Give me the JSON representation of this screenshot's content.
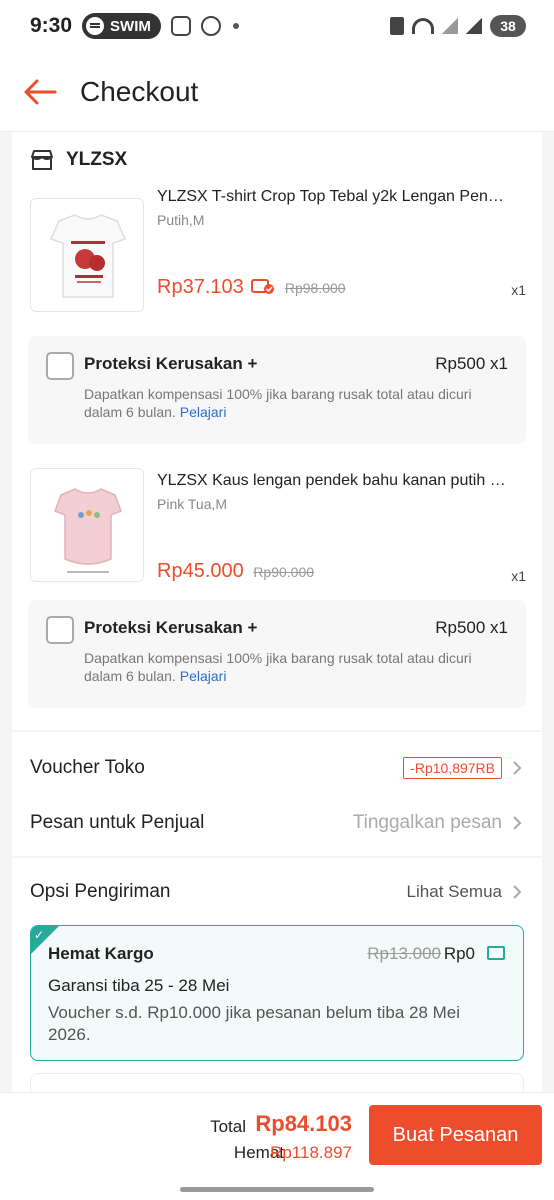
{
  "status_bar": {
    "time": "9:30",
    "pill_label": "SWIM",
    "battery": "38"
  },
  "header": {
    "title": "Checkout",
    "back_icon": "arrow-left-icon"
  },
  "shop": {
    "name": "YLZSX",
    "icon": "store-icon"
  },
  "items": [
    {
      "name": "YLZSX T-shirt Crop Top Tebal y2k Lengan Pen…",
      "variant": "Putih,M",
      "price": "Rp37.103",
      "old_price": "Rp98.000",
      "qty": "x1",
      "protection": {
        "title": "Proteksi Kerusakan +",
        "price": "Rp500 x1",
        "desc": "Dapatkan kompensasi 100% jika barang rusak total atau dicuri dalam 6 bulan.",
        "link": "Pelajari"
      }
    },
    {
      "name": "YLZSX Kaus lengan pendek bahu kanan putih …",
      "variant": "Pink Tua,M",
      "price": "Rp45.000",
      "old_price": "Rp90.000",
      "qty": "x1",
      "protection": {
        "title": "Proteksi Kerusakan +",
        "price": "Rp500 x1",
        "desc": "Dapatkan kompensasi 100% jika barang rusak total atau dicuri dalam 6 bulan.",
        "link": "Pelajari"
      }
    }
  ],
  "voucher": {
    "label": "Voucher Toko",
    "value": "-Rp10,897RB"
  },
  "message": {
    "label": "Pesan untuk Penjual",
    "placeholder": "Tinggalkan pesan"
  },
  "shipping": {
    "label": "Opsi Pengiriman",
    "see_all": "Lihat Semua",
    "option": {
      "name": "Hemat Kargo",
      "old_price": "Rp13.000",
      "price": "Rp0",
      "guarantee": "Garansi tiba 25 - 28 Mei",
      "note": "Voucher s.d.  Rp10.000 jika pesanan belum tiba 28 Mei 2026."
    }
  },
  "summary": {
    "total_label": "Total",
    "total_value": "Rp84.103",
    "save_label": "Hemat",
    "save_value": "Rp118.897",
    "order_button": "Buat Pesanan"
  },
  "colors": {
    "accent": "#ee4d2d",
    "shipping_green": "#26aa99"
  }
}
